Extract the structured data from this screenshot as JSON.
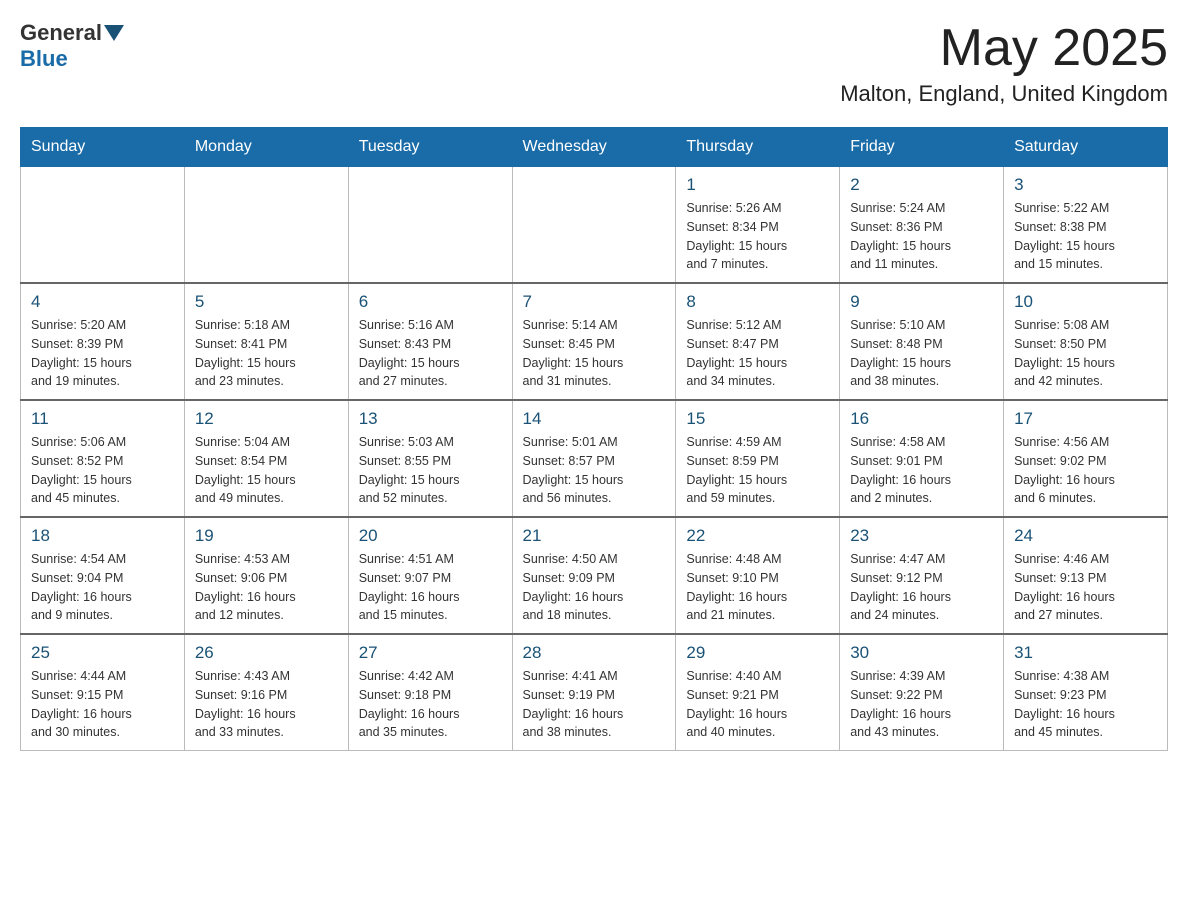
{
  "header": {
    "logo_general": "General",
    "logo_blue": "Blue",
    "month_year": "May 2025",
    "location": "Malton, England, United Kingdom"
  },
  "days_of_week": [
    "Sunday",
    "Monday",
    "Tuesday",
    "Wednesday",
    "Thursday",
    "Friday",
    "Saturday"
  ],
  "weeks": [
    [
      {
        "day": "",
        "info": ""
      },
      {
        "day": "",
        "info": ""
      },
      {
        "day": "",
        "info": ""
      },
      {
        "day": "",
        "info": ""
      },
      {
        "day": "1",
        "info": "Sunrise: 5:26 AM\nSunset: 8:34 PM\nDaylight: 15 hours\nand 7 minutes."
      },
      {
        "day": "2",
        "info": "Sunrise: 5:24 AM\nSunset: 8:36 PM\nDaylight: 15 hours\nand 11 minutes."
      },
      {
        "day": "3",
        "info": "Sunrise: 5:22 AM\nSunset: 8:38 PM\nDaylight: 15 hours\nand 15 minutes."
      }
    ],
    [
      {
        "day": "4",
        "info": "Sunrise: 5:20 AM\nSunset: 8:39 PM\nDaylight: 15 hours\nand 19 minutes."
      },
      {
        "day": "5",
        "info": "Sunrise: 5:18 AM\nSunset: 8:41 PM\nDaylight: 15 hours\nand 23 minutes."
      },
      {
        "day": "6",
        "info": "Sunrise: 5:16 AM\nSunset: 8:43 PM\nDaylight: 15 hours\nand 27 minutes."
      },
      {
        "day": "7",
        "info": "Sunrise: 5:14 AM\nSunset: 8:45 PM\nDaylight: 15 hours\nand 31 minutes."
      },
      {
        "day": "8",
        "info": "Sunrise: 5:12 AM\nSunset: 8:47 PM\nDaylight: 15 hours\nand 34 minutes."
      },
      {
        "day": "9",
        "info": "Sunrise: 5:10 AM\nSunset: 8:48 PM\nDaylight: 15 hours\nand 38 minutes."
      },
      {
        "day": "10",
        "info": "Sunrise: 5:08 AM\nSunset: 8:50 PM\nDaylight: 15 hours\nand 42 minutes."
      }
    ],
    [
      {
        "day": "11",
        "info": "Sunrise: 5:06 AM\nSunset: 8:52 PM\nDaylight: 15 hours\nand 45 minutes."
      },
      {
        "day": "12",
        "info": "Sunrise: 5:04 AM\nSunset: 8:54 PM\nDaylight: 15 hours\nand 49 minutes."
      },
      {
        "day": "13",
        "info": "Sunrise: 5:03 AM\nSunset: 8:55 PM\nDaylight: 15 hours\nand 52 minutes."
      },
      {
        "day": "14",
        "info": "Sunrise: 5:01 AM\nSunset: 8:57 PM\nDaylight: 15 hours\nand 56 minutes."
      },
      {
        "day": "15",
        "info": "Sunrise: 4:59 AM\nSunset: 8:59 PM\nDaylight: 15 hours\nand 59 minutes."
      },
      {
        "day": "16",
        "info": "Sunrise: 4:58 AM\nSunset: 9:01 PM\nDaylight: 16 hours\nand 2 minutes."
      },
      {
        "day": "17",
        "info": "Sunrise: 4:56 AM\nSunset: 9:02 PM\nDaylight: 16 hours\nand 6 minutes."
      }
    ],
    [
      {
        "day": "18",
        "info": "Sunrise: 4:54 AM\nSunset: 9:04 PM\nDaylight: 16 hours\nand 9 minutes."
      },
      {
        "day": "19",
        "info": "Sunrise: 4:53 AM\nSunset: 9:06 PM\nDaylight: 16 hours\nand 12 minutes."
      },
      {
        "day": "20",
        "info": "Sunrise: 4:51 AM\nSunset: 9:07 PM\nDaylight: 16 hours\nand 15 minutes."
      },
      {
        "day": "21",
        "info": "Sunrise: 4:50 AM\nSunset: 9:09 PM\nDaylight: 16 hours\nand 18 minutes."
      },
      {
        "day": "22",
        "info": "Sunrise: 4:48 AM\nSunset: 9:10 PM\nDaylight: 16 hours\nand 21 minutes."
      },
      {
        "day": "23",
        "info": "Sunrise: 4:47 AM\nSunset: 9:12 PM\nDaylight: 16 hours\nand 24 minutes."
      },
      {
        "day": "24",
        "info": "Sunrise: 4:46 AM\nSunset: 9:13 PM\nDaylight: 16 hours\nand 27 minutes."
      }
    ],
    [
      {
        "day": "25",
        "info": "Sunrise: 4:44 AM\nSunset: 9:15 PM\nDaylight: 16 hours\nand 30 minutes."
      },
      {
        "day": "26",
        "info": "Sunrise: 4:43 AM\nSunset: 9:16 PM\nDaylight: 16 hours\nand 33 minutes."
      },
      {
        "day": "27",
        "info": "Sunrise: 4:42 AM\nSunset: 9:18 PM\nDaylight: 16 hours\nand 35 minutes."
      },
      {
        "day": "28",
        "info": "Sunrise: 4:41 AM\nSunset: 9:19 PM\nDaylight: 16 hours\nand 38 minutes."
      },
      {
        "day": "29",
        "info": "Sunrise: 4:40 AM\nSunset: 9:21 PM\nDaylight: 16 hours\nand 40 minutes."
      },
      {
        "day": "30",
        "info": "Sunrise: 4:39 AM\nSunset: 9:22 PM\nDaylight: 16 hours\nand 43 minutes."
      },
      {
        "day": "31",
        "info": "Sunrise: 4:38 AM\nSunset: 9:23 PM\nDaylight: 16 hours\nand 45 minutes."
      }
    ]
  ]
}
